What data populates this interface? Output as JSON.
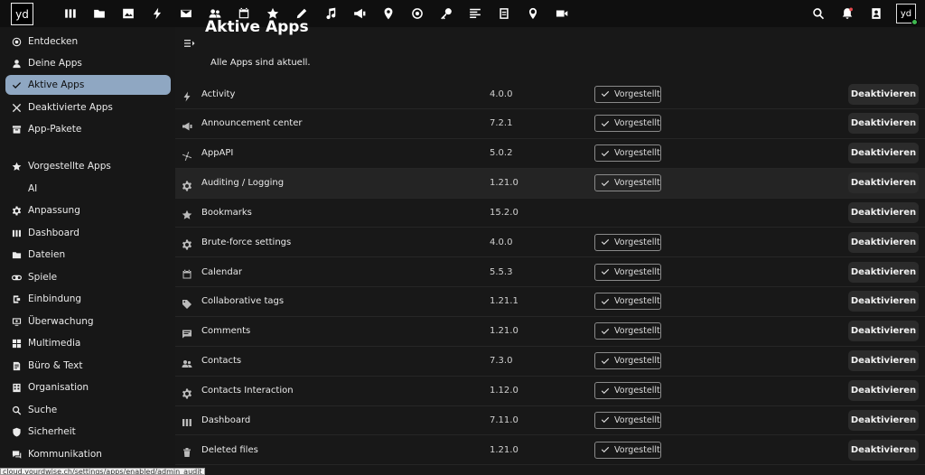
{
  "topbar": {
    "logo_text": "yd",
    "app_icons": [
      "dashboard-icon",
      "folder-icon",
      "photos-icon",
      "activity-icon",
      "mail-icon",
      "contacts-icon",
      "calendar-icon",
      "star-icon",
      "notes-icon",
      "music-icon",
      "announcement-icon",
      "maps-icon",
      "radio-icon",
      "passwords-icon",
      "news-icon",
      "forms-icon",
      "location-icon",
      "video-icon"
    ],
    "right_icons": [
      "search-icon",
      "notifications-icon",
      "contacts-menu-icon"
    ],
    "avatar_text": "yd"
  },
  "sidebar": {
    "items": [
      {
        "label": "Entdecken",
        "icon": "discover-icon",
        "active": false
      },
      {
        "label": "Deine Apps",
        "icon": "user-icon",
        "active": false
      },
      {
        "label": "Aktive Apps",
        "icon": "check-icon",
        "active": true
      },
      {
        "label": "Deaktivierte Apps",
        "icon": "close-icon",
        "active": false
      },
      {
        "label": "App-Pakete",
        "icon": "package-icon",
        "active": false
      },
      {
        "label": "Vorgestellte Apps",
        "icon": "star-icon",
        "active": false
      },
      {
        "label": "AI",
        "icon": "",
        "active": false
      },
      {
        "label": "Anpassung",
        "icon": "gear-icon",
        "active": false
      },
      {
        "label": "Dashboard",
        "icon": "dashboard-icon",
        "active": false
      },
      {
        "label": "Dateien",
        "icon": "folder-icon",
        "active": false
      },
      {
        "label": "Spiele",
        "icon": "gamepad-icon",
        "active": false
      },
      {
        "label": "Einbindung",
        "icon": "integration-icon",
        "active": false
      },
      {
        "label": "Überwachung",
        "icon": "monitor-icon",
        "active": false
      },
      {
        "label": "Multimedia",
        "icon": "multimedia-icon",
        "active": false
      },
      {
        "label": "Büro & Text",
        "icon": "office-icon",
        "active": false
      },
      {
        "label": "Organisation",
        "icon": "organization-icon",
        "active": false
      },
      {
        "label": "Suche",
        "icon": "search-icon",
        "active": false
      },
      {
        "label": "Sicherheit",
        "icon": "security-icon",
        "active": false
      },
      {
        "label": "Kommunikation",
        "icon": "chat-icon",
        "active": false
      }
    ]
  },
  "main": {
    "title": "Aktive Apps",
    "subtitle": "Alle Apps sind aktuell.",
    "featured_label": "Vorgestellt",
    "action_label": "Deaktivieren",
    "apps": [
      {
        "name": "Activity",
        "version": "4.0.0",
        "featured": true,
        "icon": "activity-icon"
      },
      {
        "name": "Announcement center",
        "version": "7.2.1",
        "featured": true,
        "icon": "announcement-icon"
      },
      {
        "name": "AppAPI",
        "version": "5.0.2",
        "featured": true,
        "icon": "appapi-icon"
      },
      {
        "name": "Auditing / Logging",
        "version": "1.21.0",
        "featured": true,
        "icon": "gear-icon"
      },
      {
        "name": "Bookmarks",
        "version": "15.2.0",
        "featured": false,
        "icon": "star-icon"
      },
      {
        "name": "Brute-force settings",
        "version": "4.0.0",
        "featured": true,
        "icon": "gear-icon"
      },
      {
        "name": "Calendar",
        "version": "5.5.3",
        "featured": true,
        "icon": "calendar-icon"
      },
      {
        "name": "Collaborative tags",
        "version": "1.21.1",
        "featured": true,
        "icon": "tag-icon"
      },
      {
        "name": "Comments",
        "version": "1.21.0",
        "featured": true,
        "icon": "comment-icon"
      },
      {
        "name": "Contacts",
        "version": "7.3.0",
        "featured": true,
        "icon": "contacts-icon"
      },
      {
        "name": "Contacts Interaction",
        "version": "1.12.0",
        "featured": true,
        "icon": "gear-icon"
      },
      {
        "name": "Dashboard",
        "version": "7.11.0",
        "featured": true,
        "icon": "dashboard-icon"
      },
      {
        "name": "Deleted files",
        "version": "1.21.0",
        "featured": true,
        "icon": "trash-icon"
      }
    ]
  },
  "statusbar": {
    "url": "cloud.yourdwise.ch/settings/apps/enabled/admin_audit"
  }
}
